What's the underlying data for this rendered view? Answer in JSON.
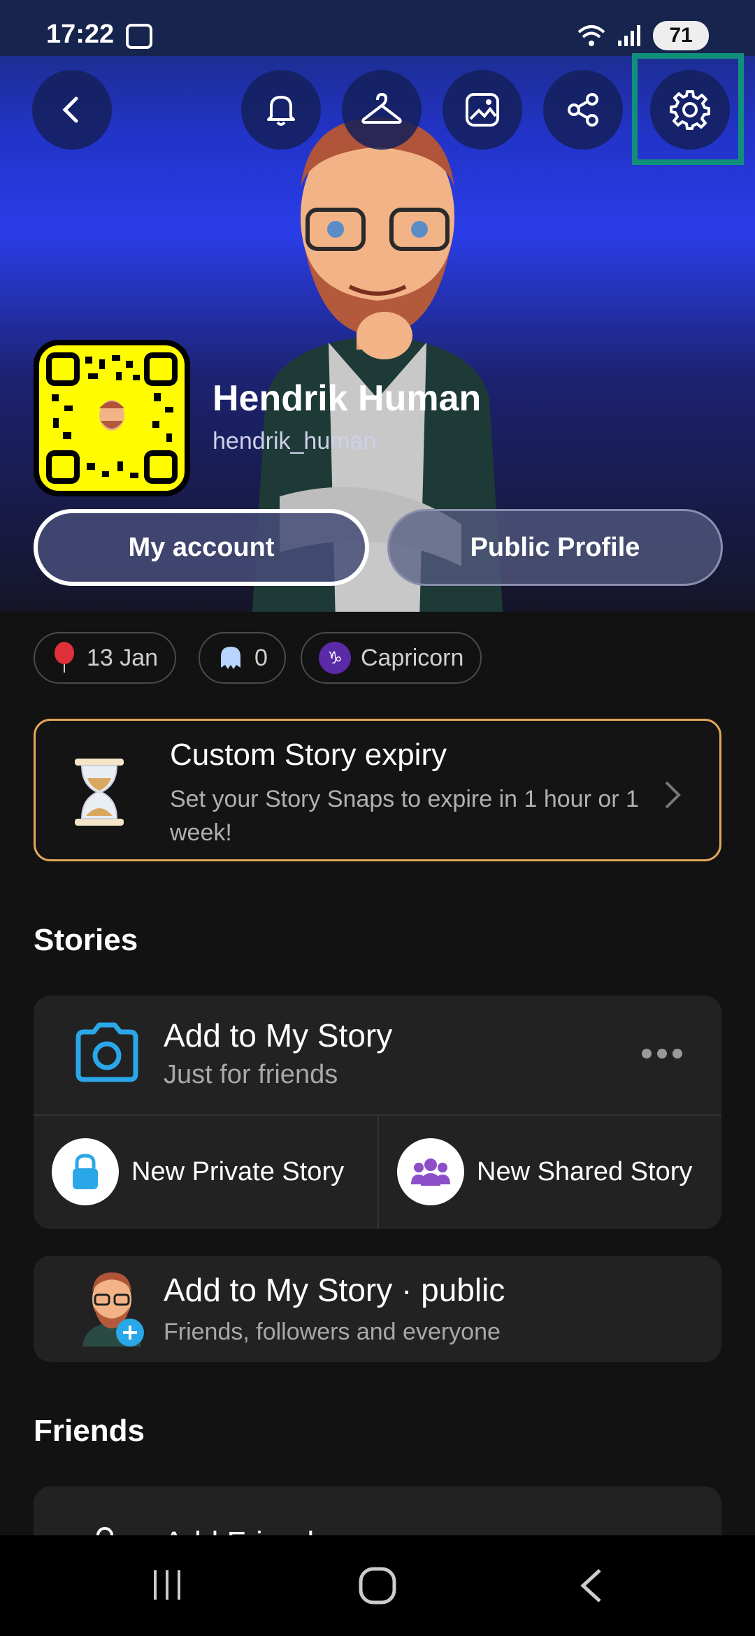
{
  "status": {
    "time": "17:22",
    "battery": "71"
  },
  "profile": {
    "name": "Hendrik Human",
    "username": "hendrik_human"
  },
  "buttons": {
    "my_account": "My account",
    "public_profile": "Public Profile"
  },
  "chips": [
    {
      "label": "13 Jan",
      "icon": "balloon-icon"
    },
    {
      "label": "0",
      "icon": "ghost-icon"
    },
    {
      "label": "Capricorn",
      "icon": "capricorn-icon"
    }
  ],
  "expiry": {
    "title": "Custom Story expiry",
    "subtitle": "Set your Story Snaps to expire in 1 hour or 1 week!"
  },
  "sections": {
    "stories": "Stories",
    "friends": "Friends"
  },
  "my_story": {
    "title": "Add to My Story",
    "subtitle": "Just for friends",
    "private_label": "New Private Story",
    "shared_label": "New Shared Story"
  },
  "public_story": {
    "title": "Add to My Story · public",
    "subtitle": "Friends, followers and everyone"
  },
  "friends": {
    "add_label": "Add Friends"
  },
  "colors": {
    "accent_highlight": "#10907a",
    "snapcode_yellow": "#fffc00",
    "expiry_border": "#e3a55a",
    "camera_blue": "#2aa7e8"
  }
}
